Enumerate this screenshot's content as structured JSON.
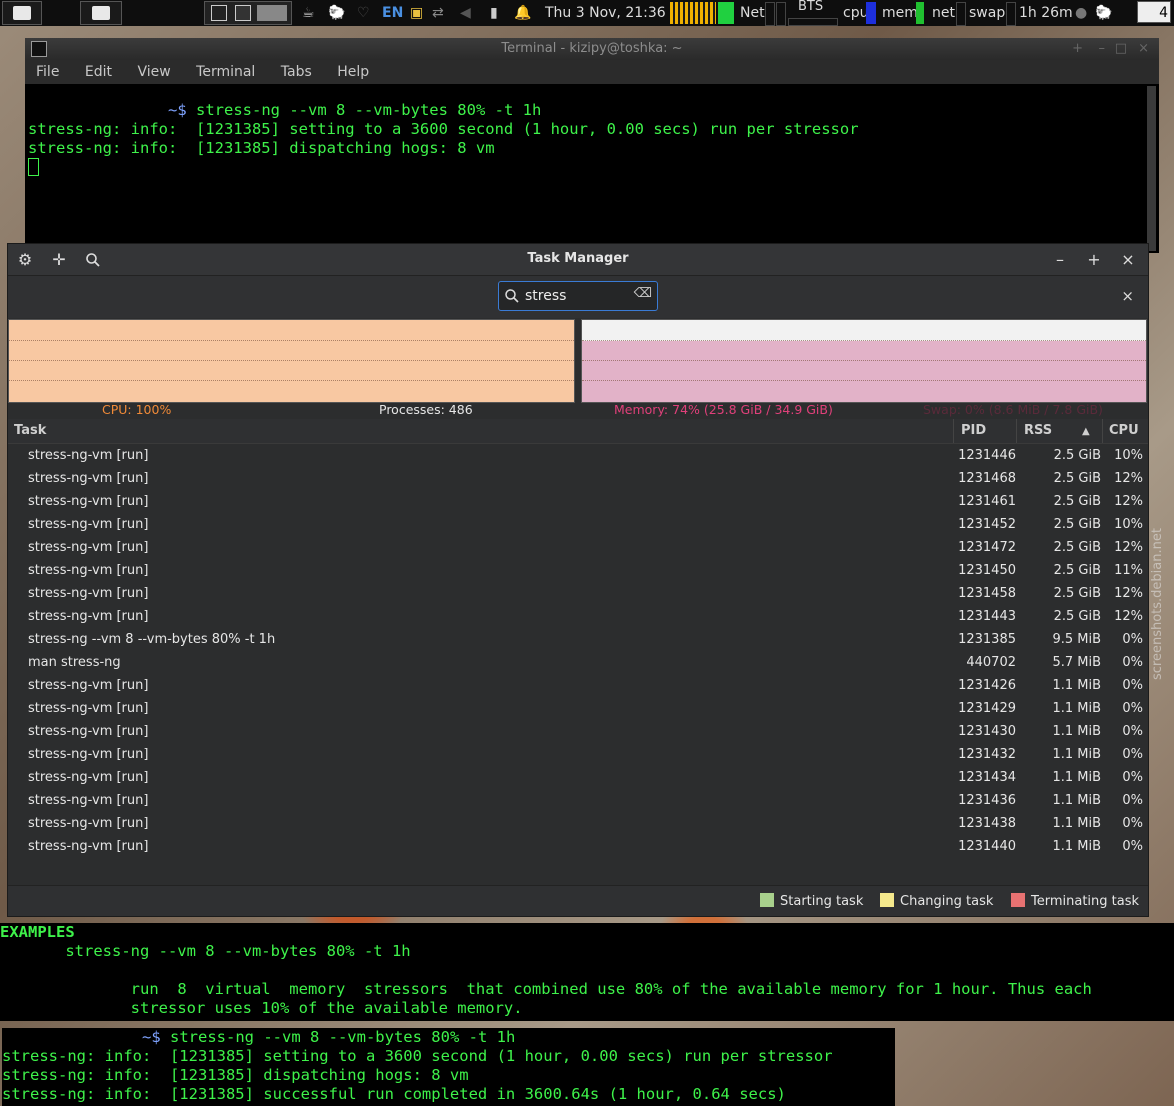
{
  "panel": {
    "kbd_layout": "EN",
    "clock": "Thu  3 Nov, 21:36",
    "net_label": "Net",
    "bts_label": "BTS",
    "cpu_label": "cpu",
    "mem_label": "mem",
    "net2_label": "net",
    "swap_label": "swap",
    "battery_time": "1h 26m",
    "workspace": "4"
  },
  "terminal": {
    "title": "Terminal - kizipy@toshka: ~",
    "menu": [
      "File",
      "Edit",
      "View",
      "Terminal",
      "Tabs",
      "Help"
    ],
    "prompt": "~$",
    "command": " stress-ng --vm 8 --vm-bytes 80% -t 1h",
    "lines": [
      "stress-ng: info:  [1231385] setting to a 3600 second (1 hour, 0.00 secs) run per stressor",
      "stress-ng: info:  [1231385] dispatching hogs: 8 vm"
    ]
  },
  "task_manager": {
    "title": "Task Manager",
    "search_value": "stress",
    "cpu_label": "CPU: 100%",
    "processes_label": "Processes: 486",
    "memory_label": "Memory: 74% (25.8  GiB / 34.9  GiB)",
    "swap_label": "Swap: 0% (8.6  MiB / 7.8  GiB)",
    "cpu_percent": 100,
    "memory_percent": 74,
    "columns": {
      "task": "Task",
      "pid": "PID",
      "rss": "RSS",
      "cpu": "CPU"
    },
    "rows": [
      {
        "task": "stress-ng-vm [run]",
        "pid": "1231446",
        "rss": "2.5  GiB",
        "cpu": "10%"
      },
      {
        "task": "stress-ng-vm [run]",
        "pid": "1231468",
        "rss": "2.5  GiB",
        "cpu": "12%"
      },
      {
        "task": "stress-ng-vm [run]",
        "pid": "1231461",
        "rss": "2.5  GiB",
        "cpu": "12%"
      },
      {
        "task": "stress-ng-vm [run]",
        "pid": "1231452",
        "rss": "2.5  GiB",
        "cpu": "10%"
      },
      {
        "task": "stress-ng-vm [run]",
        "pid": "1231472",
        "rss": "2.5  GiB",
        "cpu": "12%"
      },
      {
        "task": "stress-ng-vm [run]",
        "pid": "1231450",
        "rss": "2.5  GiB",
        "cpu": "11%"
      },
      {
        "task": "stress-ng-vm [run]",
        "pid": "1231458",
        "rss": "2.5  GiB",
        "cpu": "12%"
      },
      {
        "task": "stress-ng-vm [run]",
        "pid": "1231443",
        "rss": "2.5  GiB",
        "cpu": "12%"
      },
      {
        "task": "stress-ng --vm 8 --vm-bytes 80% -t 1h",
        "pid": "1231385",
        "rss": "9.5  MiB",
        "cpu": "0%"
      },
      {
        "task": "man stress-ng",
        "pid": "440702",
        "rss": "5.7  MiB",
        "cpu": "0%"
      },
      {
        "task": "stress-ng-vm [run]",
        "pid": "1231426",
        "rss": "1.1  MiB",
        "cpu": "0%"
      },
      {
        "task": "stress-ng-vm [run]",
        "pid": "1231429",
        "rss": "1.1  MiB",
        "cpu": "0%"
      },
      {
        "task": "stress-ng-vm [run]",
        "pid": "1231430",
        "rss": "1.1  MiB",
        "cpu": "0%"
      },
      {
        "task": "stress-ng-vm [run]",
        "pid": "1231432",
        "rss": "1.1  MiB",
        "cpu": "0%"
      },
      {
        "task": "stress-ng-vm [run]",
        "pid": "1231434",
        "rss": "1.1  MiB",
        "cpu": "0%"
      },
      {
        "task": "stress-ng-vm [run]",
        "pid": "1231436",
        "rss": "1.1  MiB",
        "cpu": "0%"
      },
      {
        "task": "stress-ng-vm [run]",
        "pid": "1231438",
        "rss": "1.1  MiB",
        "cpu": "0%"
      },
      {
        "task": "stress-ng-vm [run]",
        "pid": "1231440",
        "rss": "1.1  MiB",
        "cpu": "0%"
      }
    ],
    "legend": {
      "starting": "Starting task",
      "changing": "Changing task",
      "terminating": "Terminating task"
    },
    "colors": {
      "cpu_graph": "#f8c8a2",
      "memory_graph": "#e2b2c8",
      "cpu_text": "#f08a38",
      "memory_text": "#e0407a",
      "starting": "#a8d08c",
      "changing": "#f4e88c",
      "terminating": "#e87272"
    }
  },
  "man_page": {
    "heading": "EXAMPLES",
    "example": "stress-ng --vm 8 --vm-bytes 80% -t 1h",
    "desc1": "run  8  virtual  memory  stressors  that combined use 80% of the available memory for 1 hour. Thus each",
    "desc2": "stressor uses 10% of the available memory."
  },
  "terminal2": {
    "prompt": "~$",
    "command": " stress-ng --vm 8 --vm-bytes 80% -t 1h",
    "lines": [
      "stress-ng: info:  [1231385] setting to a 3600 second (1 hour, 0.00 secs) run per stressor",
      "stress-ng: info:  [1231385] dispatching hogs: 8 vm",
      "stress-ng: info:  [1231385] successful run completed in 3600.64s (1 hour, 0.64 secs)"
    ]
  },
  "watermark": "screenshots.debian.net"
}
